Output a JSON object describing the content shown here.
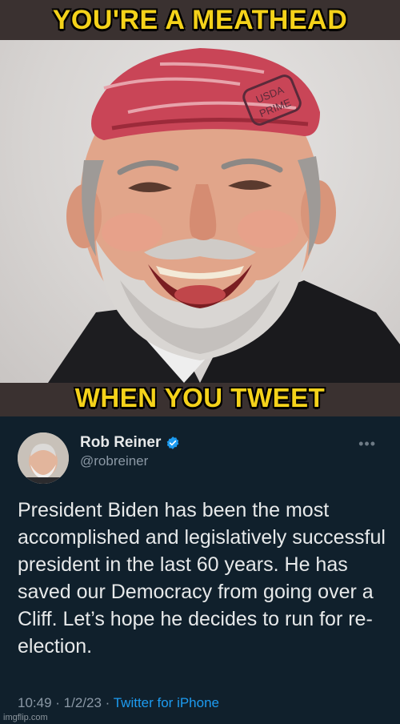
{
  "captions": {
    "top": "YOU'RE  A MEATHEAD",
    "bottom": "WHEN YOU TWEET"
  },
  "photo": {
    "stamp_line1": "USDA",
    "stamp_line2": "PRIME"
  },
  "tweet": {
    "name": "Rob Reiner",
    "handle": "@robreiner",
    "more_label": "•••",
    "text": "President Biden has been the most accomplished and legislatively successful president in the last 60 years. He has saved our Democracy from going over a Cliff. Let’s hope he decides to run for re-election.",
    "time": "10:49 · 1/2/23 · ",
    "source": "Twitter for iPhone",
    "verified_icon": "verified-badge-icon"
  },
  "watermark": "imgflip.com",
  "colors": {
    "caption": "#f4d21a",
    "bar": "#3a3130",
    "tweet_bg": "#10202c",
    "link": "#1d9bf0",
    "meat": "#c94557"
  }
}
